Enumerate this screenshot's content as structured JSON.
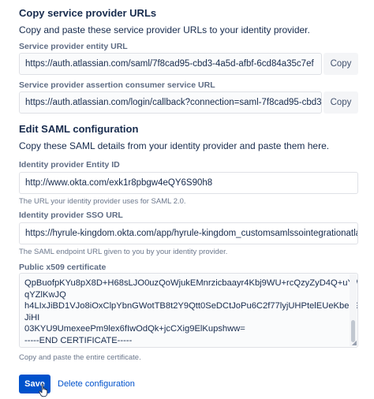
{
  "sp_urls": {
    "title": "Copy service provider URLs",
    "description": "Copy and paste these service provider URLs to your identity provider.",
    "entity": {
      "label": "Service provider entity URL",
      "value": "https://auth.atlassian.com/saml/7f8cad95-cbd3-4a5d-afbf-6cd84a35c7ef",
      "copy_label": "Copy"
    },
    "acs": {
      "label": "Service provider assertion consumer service URL",
      "value": "https://auth.atlassian.com/login/callback?connection=saml-7f8cad95-cbd3-4a5d",
      "copy_label": "Copy"
    }
  },
  "saml_config": {
    "title": "Edit SAML configuration",
    "description": "Copy these SAML details from your identity provider and paste them here.",
    "entity_id": {
      "label": "Identity provider Entity ID",
      "value": "http://www.okta.com/exk1r8pbgw4eQY6S90h8",
      "help": "The URL your identity provider uses for SAML 2.0."
    },
    "sso_url": {
      "label": "Identity provider SSO URL",
      "value": "https://hyrule-kingdom.okta.com/app/hyrule-kingdom_customsamlssointegrationatlassianc",
      "help": "The SAML endpoint URL given to you by your identity provider."
    },
    "certificate": {
      "label": "Public x509 certificate",
      "lines": [
        "QpBuofpKYu8pX8D+H68sLJO0uzQoWjukEMnrzicbaayr4Kbj9WU+rcQzyZyD4Q+uYWei",
        "qYZlKwJQ",
        "h4LIxJiBD1VJo8iOxClpYbnGWotTB8t2Y9Qtt0SeDCtJoPu6C2f77lyjUHPtelEUeKbed9",
        "JiHI",
        "03KYU9UmexeePm9lex6fIwOdQk+jcCXig9ElKupshww=",
        "-----END CERTIFICATE-----"
      ],
      "help": "Copy and paste the entire certificate."
    }
  },
  "actions": {
    "save_label": "Save",
    "delete_label": "Delete configuration"
  },
  "colors": {
    "primary": "#0052cc",
    "text": "#172b4d",
    "subtle": "#5e6c84"
  }
}
